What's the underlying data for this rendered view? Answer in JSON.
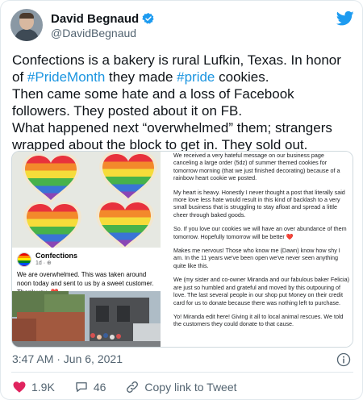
{
  "author": {
    "display_name": "David Begnaud",
    "handle": "@DavidBegnaud"
  },
  "tweet": {
    "segments": [
      {
        "text": "Confections is a bakery is rural Lufkin, Texas. In honor of ",
        "hashtag": false
      },
      {
        "text": "#PrideMonth",
        "hashtag": true
      },
      {
        "text": " they made ",
        "hashtag": false
      },
      {
        "text": "#pride",
        "hashtag": true
      },
      {
        "text": " cookies.\nThen came some hate and a loss of Facebook followers. They posted about it on FB.\nWhat happened next “overwhelmed” them; strangers wrapped about the block to get in. They sold out.",
        "hashtag": false
      }
    ],
    "timestamp": "3:47 AM · Jun 6, 2021"
  },
  "facebook_post": {
    "page_name": "Confections",
    "time": "1d · ⊕",
    "text": "We are overwhelmed. This was taken around noon today and sent to us by a sweet customer. Thank you. ❤️"
  },
  "letter": {
    "paragraphs": [
      "We received a very hateful message on our business page canceling a large order (5dz) of summer themed cookies for tomorrow morning (that we just finished decorating) because of a rainbow heart cookie we posted.",
      "My heart is heavy. Honestly I never thought a post that literally said more love less hate would result in this kind of backlash to a very small business that is struggling to stay afloat and spread a little cheer through baked goods.",
      "So. If you love our cookies we will have an over abundance of them tomorrow. Hopefully tomorrow will be better ❤️",
      "Makes me nervous! Those who know me (Dawn) know how shy I am. In the 11 years we've been open we've never seen anything quite like this.",
      "We (my sister and co-owner Miranda and our fabulous baker Felicia) are just so humbled and grateful and moved by this outpouring of love. The last several people in our shop put Money on their credit card for us to donate because there was nothing left to purchase.",
      "Yo! Miranda edit here! Giving it all to local animal rescues. We told the customers they could donate to that cause."
    ]
  },
  "actions": {
    "likes": "1.9K",
    "replies": "46",
    "copy_link": "Copy link to Tweet"
  },
  "icons": {
    "verified": "verified-badge-icon",
    "brand": "twitter-bird-icon",
    "info": "info-icon",
    "like": "heart-icon",
    "reply": "reply-bubble-icon",
    "copy": "link-icon"
  },
  "colors": {
    "brand_blue": "#1d9bf0",
    "hashtag": "#1b95e0",
    "secondary_text": "#536471",
    "like_red": "#e0245e"
  }
}
